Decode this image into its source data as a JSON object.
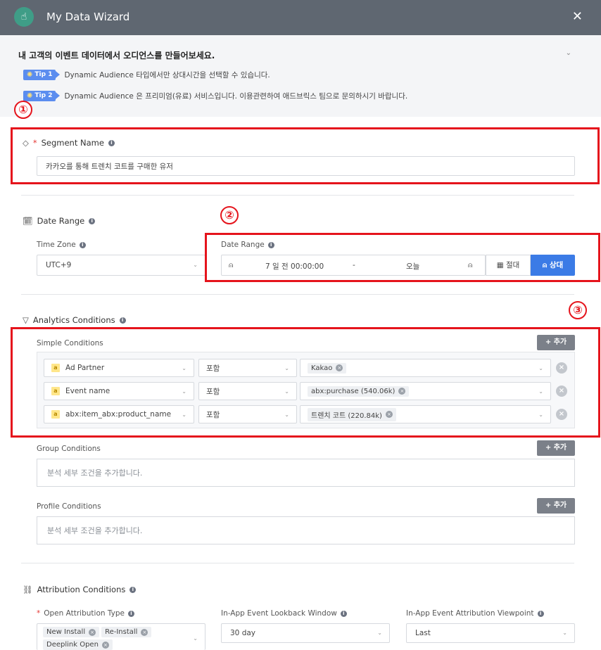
{
  "window": {
    "title": "My Data Wizard",
    "icon": "pointer-hand-icon",
    "close_label": "✕"
  },
  "intro": {
    "title": "내 고객의 이벤트 데이터에서 오디언스를 만들어보세요.",
    "tips": [
      {
        "badge": "Tip 1",
        "text": "Dynamic Audience 타입에서만 상대시간을 선택할 수 있습니다."
      },
      {
        "badge": "Tip 2",
        "text": "Dynamic Audience 은 프리미엄(유료) 서비스입니다. 이용관련하여 애드브릭스 팀으로 문의하시기 바랍니다."
      }
    ]
  },
  "annotations": [
    "①",
    "②",
    "③"
  ],
  "segment": {
    "label": "Segment Name",
    "required_mark": "*",
    "value": "카카오를 통해 트렌치 코트를 구매한 유저"
  },
  "date_range": {
    "section_title": "Date Range",
    "timezone_label": "Time Zone",
    "timezone_value": "UTC+9",
    "range_label": "Date Range",
    "start": "7 일 전 00:00:00",
    "separator": "-",
    "end": "오늘",
    "absolute_label": "절대",
    "relative_label": "상대"
  },
  "analytics": {
    "section_title": "Analytics Conditions",
    "simple_title": "Simple Conditions",
    "add_label": "+ 추가",
    "badge": "a",
    "rows": [
      {
        "field": "Ad Partner",
        "operator": "포함",
        "values": [
          "Kakao"
        ]
      },
      {
        "field": "Event name",
        "operator": "포함",
        "values": [
          "abx:purchase (540.06k)"
        ]
      },
      {
        "field": "abx:item_abx:product_name",
        "operator": "포함",
        "values": [
          "트렌치 코트 (220.84k)"
        ]
      }
    ],
    "group_title": "Group Conditions",
    "group_placeholder": "분석 세부 조건을 추가합니다.",
    "profile_title": "Profile Conditions",
    "profile_placeholder": "분석 세부 조건을 추가합니다."
  },
  "attribution": {
    "section_title": "Attribution Conditions",
    "open_type_label": "Open Attribution Type",
    "open_type_values": [
      "New Install",
      "Re-Install",
      "Deeplink Open"
    ],
    "lookback_label": "In-App Event Lookback Window",
    "lookback_value": "30 day",
    "viewpoint_label": "In-App Event Attribution Viewpoint",
    "viewpoint_value": "Last"
  },
  "colors": {
    "header": "#5f6771",
    "accent": "#3b7be6",
    "highlight": "#e5141c",
    "tip": "#5b8def"
  }
}
